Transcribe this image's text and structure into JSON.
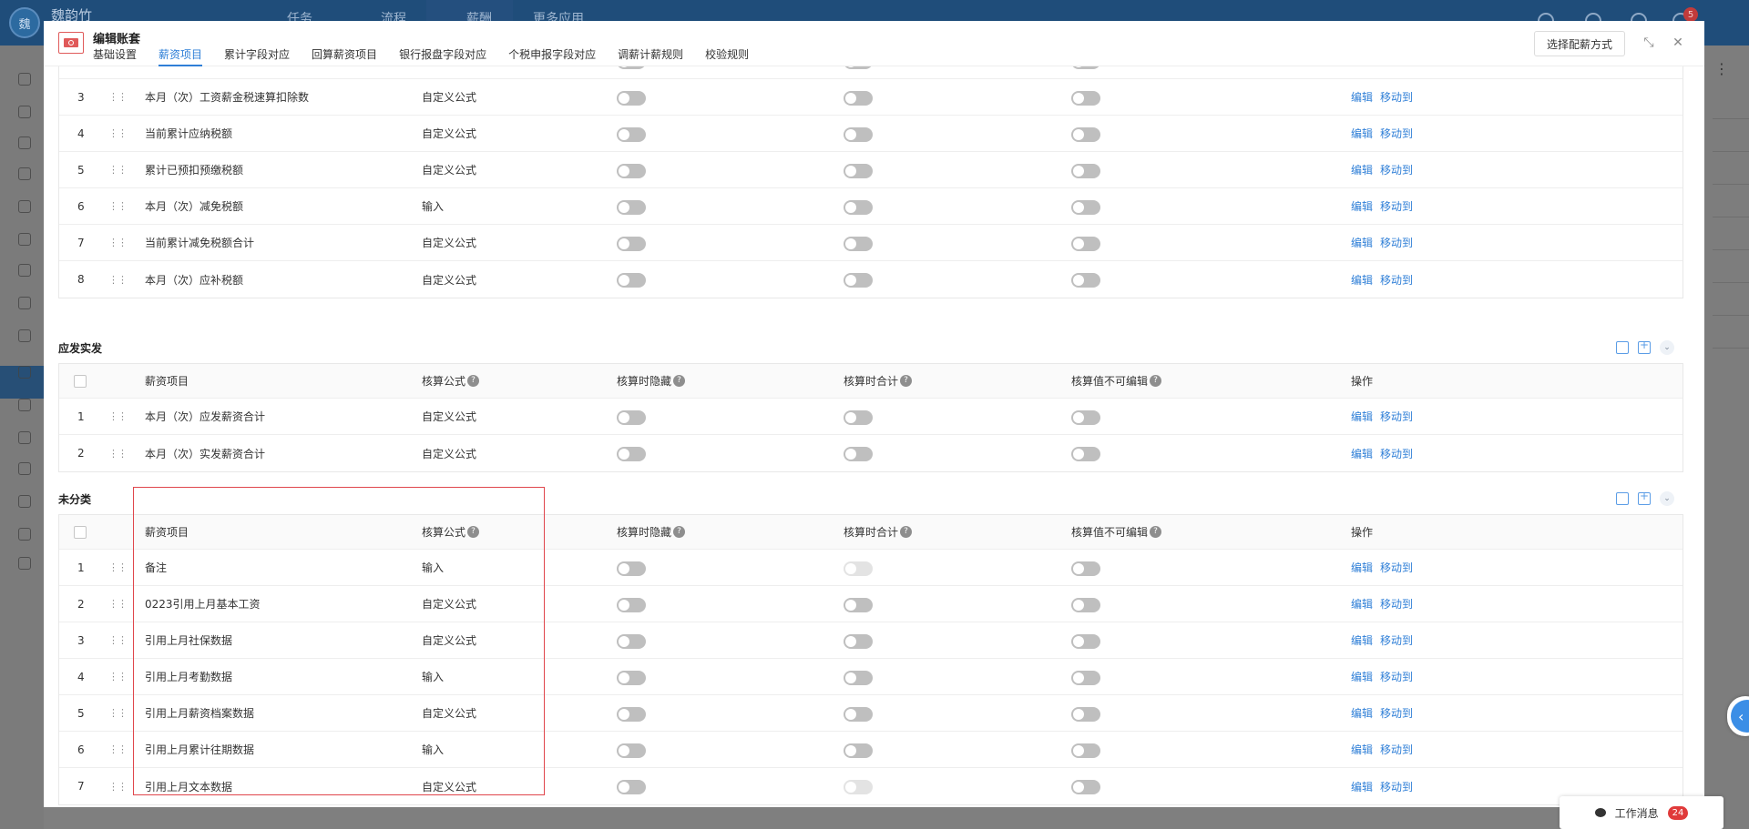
{
  "app": {
    "user_initial": "魏",
    "user_name": "魏韵竹",
    "nav": [
      "任务",
      "流程",
      "薪酬",
      "更多应用"
    ],
    "notification_count": "5"
  },
  "modal": {
    "title": "编辑账套",
    "tabs": [
      "基础设置",
      "薪资项目",
      "累计字段对应",
      "回算薪资项目",
      "银行报盘字段对应",
      "个税申报字段对应",
      "调薪计薪规则",
      "校验规则"
    ],
    "active_tab": "薪资项目",
    "select_button": "选择配薪方式"
  },
  "columns": {
    "check": "",
    "name": "薪资项目",
    "formula": "核算公式",
    "hide": "核算时隐藏",
    "sum": "核算时合计",
    "noedit": "核算值不可编辑",
    "ops": "操作"
  },
  "ops": {
    "edit": "编辑",
    "move": "移动到"
  },
  "sections": {
    "tax": {
      "rows": [
        {
          "n": "3",
          "name": "本月（次）工资薪金税速算扣除数",
          "formula": "自定义公式"
        },
        {
          "n": "4",
          "name": "当前累计应纳税额",
          "formula": "自定义公式"
        },
        {
          "n": "5",
          "name": "累计已预扣预缴税额",
          "formula": "自定义公式"
        },
        {
          "n": "6",
          "name": "本月（次）减免税额",
          "formula": "输入"
        },
        {
          "n": "7",
          "name": "当前累计减免税额合计",
          "formula": "自定义公式"
        },
        {
          "n": "8",
          "name": "本月（次）应补税额",
          "formula": "自定义公式"
        }
      ]
    },
    "pay": {
      "title": "应发实发",
      "rows": [
        {
          "n": "1",
          "name": "本月（次）应发薪资合计",
          "formula": "自定义公式"
        },
        {
          "n": "2",
          "name": "本月（次）实发薪资合计",
          "formula": "自定义公式"
        }
      ]
    },
    "uncat": {
      "title": "未分类",
      "rows": [
        {
          "n": "1",
          "name": "备注",
          "formula": "输入"
        },
        {
          "n": "2",
          "name": "0223引用上月基本工资",
          "formula": "自定义公式"
        },
        {
          "n": "3",
          "name": "引用上月社保数据",
          "formula": "自定义公式"
        },
        {
          "n": "4",
          "name": "引用上月考勤数据",
          "formula": "输入"
        },
        {
          "n": "5",
          "name": "引用上月薪资档案数据",
          "formula": "自定义公式"
        },
        {
          "n": "6",
          "name": "引用上月累计往期数据",
          "formula": "输入"
        },
        {
          "n": "7",
          "name": "引用上月文本数据",
          "formula": "自定义公式"
        }
      ]
    }
  },
  "messages": {
    "label": "工作消息",
    "count": "24"
  }
}
